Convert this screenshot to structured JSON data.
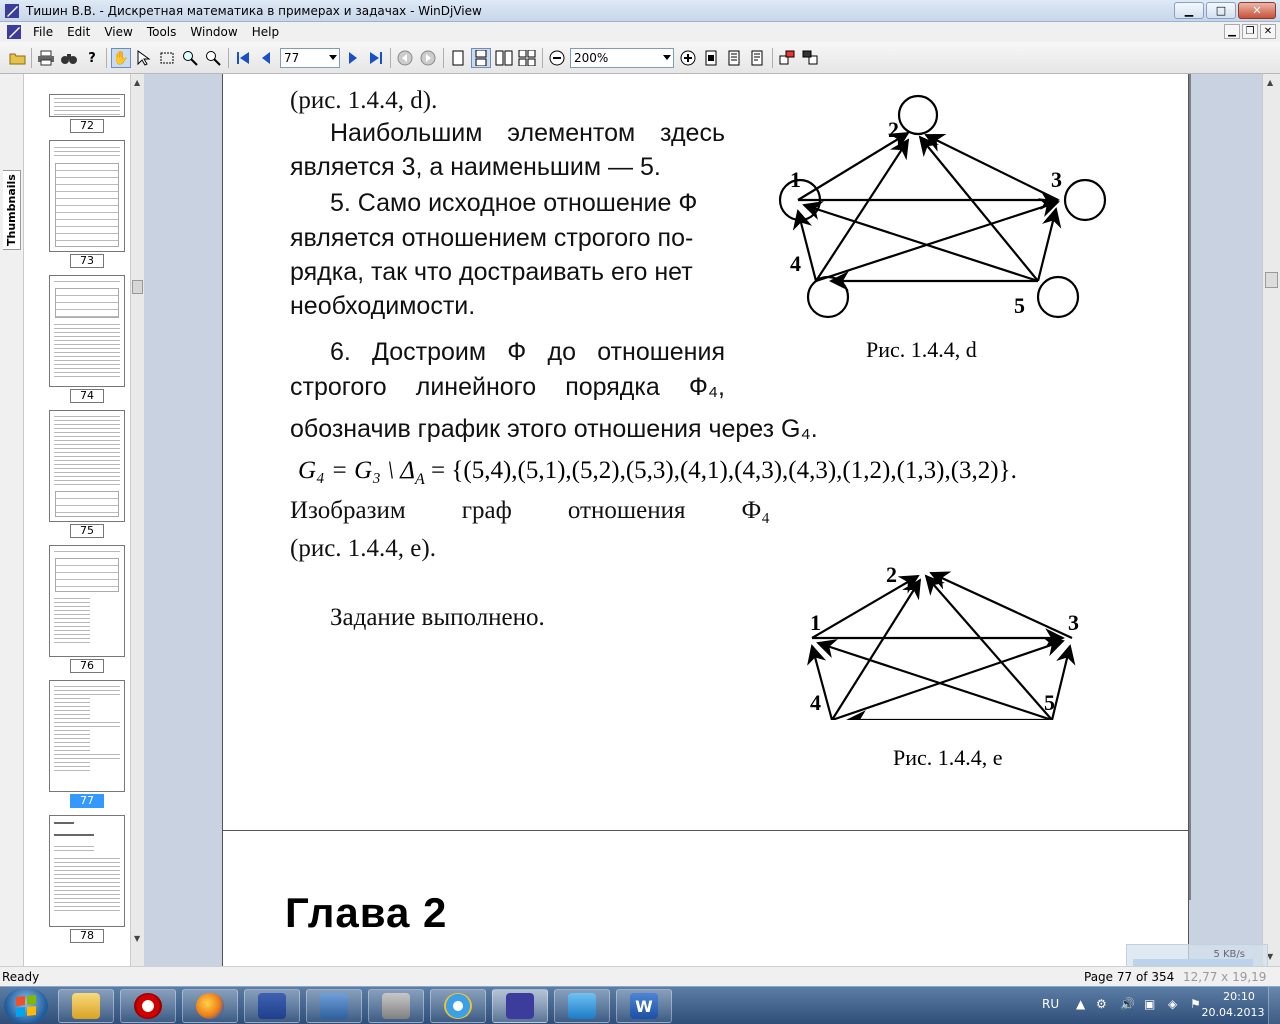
{
  "window": {
    "title": "Тишин В.В. - Дискретная математика в примерах и задачах - WinDjView",
    "min_glyph": "▁",
    "max_glyph": "□",
    "close_glyph": "✕"
  },
  "menu": {
    "items": [
      "File",
      "Edit",
      "View",
      "Tools",
      "Window",
      "Help"
    ],
    "mdi_buttons": [
      "▁",
      "❐",
      "✕"
    ]
  },
  "toolbar": {
    "page_value": "77",
    "zoom_value": "200%"
  },
  "sidebar": {
    "tab_label": "Thumbnails",
    "thumbnails": [
      {
        "page": "72",
        "selected": false
      },
      {
        "page": "73",
        "selected": false
      },
      {
        "page": "74",
        "selected": false
      },
      {
        "page": "75",
        "selected": false
      },
      {
        "page": "76",
        "selected": false
      },
      {
        "page": "77",
        "selected": true
      },
      {
        "page": "78",
        "selected": false
      }
    ]
  },
  "document": {
    "lines": {
      "l1": "(рис. 1.4.4, d).",
      "l2": "Наибольшим элементом здесь",
      "l3": "является 3, а наименьшим — 5.",
      "l4": "5. Само исходное отношение Ф",
      "l5": "является отношением строгого по-",
      "l6": "рядка, так что достраивать его нет",
      "l7": "необходимости.",
      "l8": "6. Достроим Ф до отношения",
      "l9": "строгого линейного порядка Ф₄,",
      "l10": "обозначив график этого отношения через G₄.",
      "l12a": "Изобразим граф отношения Ф₄",
      "l13": "(рис. 1.4.4, е).",
      "l14": "Задание выполнено."
    },
    "formula": {
      "lhs": "G₄ = G₃ \\ Δ",
      "lhs_sub": "A",
      "rhs": " = {(5,4),(5,1),(5,2),(5,3),(4,1),(4,3),(4,3),(1,2),(1,3),(3,2)}."
    },
    "caption_d": "Рис. 1.4.4, d",
    "caption_e": "Рис. 1.4.4, e",
    "graph_d_labels": [
      "1",
      "2",
      "3",
      "4",
      "5"
    ],
    "graph_e_labels": [
      "1",
      "2",
      "3",
      "4",
      "5"
    ],
    "chapter_heading": "Глава 2"
  },
  "status": {
    "ready": "Ready",
    "page_info": "Page 77 of 354",
    "size_info": "12,77 x 19,19 cm"
  },
  "net_meter": {
    "speed": "5 KB/s"
  },
  "taskbar": {
    "tray_language": "RU",
    "time": "20:10",
    "date": "20.04.2013"
  }
}
